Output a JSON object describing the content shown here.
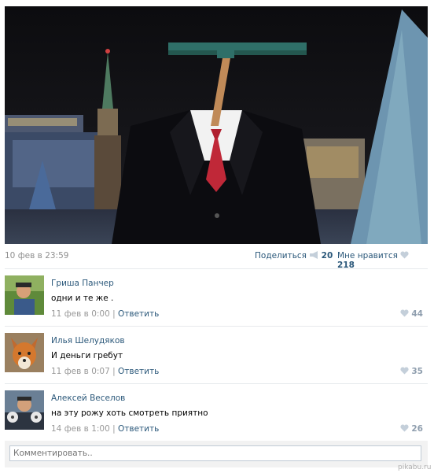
{
  "post": {
    "date": "10 фев в 23:59",
    "share_label": "Поделиться",
    "share_count": "20",
    "like_label": "Мне нравится",
    "like_count": "218",
    "colors": {
      "link": "#2b587a",
      "muted": "#8f8f8f",
      "like_icon": "#c4cfda"
    }
  },
  "comments": [
    {
      "name": "Гриша Панчер",
      "text": "одни и те же .",
      "date": "11 фев в 0:00",
      "reply": "Ответить",
      "likes": "44"
    },
    {
      "name": "Илья Шелудяков",
      "text": "И деньги гребут",
      "date": "11 фев в 0:07",
      "reply": "Ответить",
      "likes": "35"
    },
    {
      "name": "Алексей Веселов",
      "text": "на эту рожу хоть смотреть приятно",
      "date": "14 фев в 1:00",
      "reply": "Ответить",
      "likes": "26"
    }
  ],
  "comment_box": {
    "placeholder": "Комментировать.."
  },
  "watermark": "pikabu.ru",
  "icons": {
    "share": "megaphone-icon",
    "like": "heart-icon"
  }
}
